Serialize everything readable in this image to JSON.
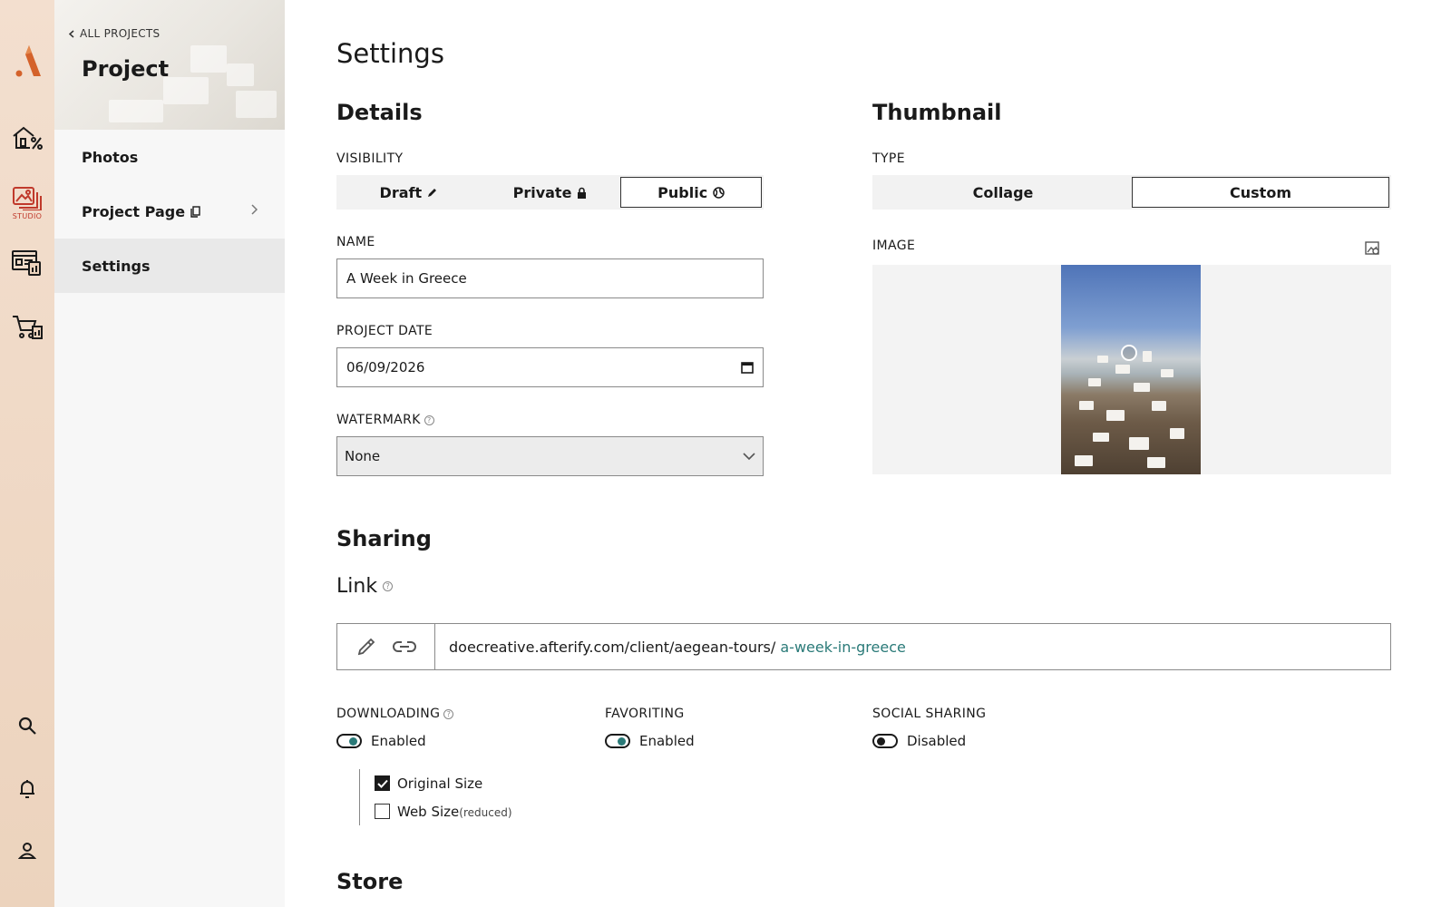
{
  "rail": {
    "logo": "afterify-logo-icon",
    "items": [
      {
        "name": "home-clients",
        "icon": "house-percent-icon"
      },
      {
        "name": "studio",
        "icon": "gallery-icon",
        "label": "STUDIO",
        "active": true
      },
      {
        "name": "websites",
        "icon": "website-icon"
      },
      {
        "name": "store",
        "icon": "cart-icon"
      }
    ],
    "bottom": [
      "search-icon",
      "bell-icon",
      "user-icon"
    ],
    "accent": "#c0392b"
  },
  "sidebar": {
    "back_label": "ALL PROJECTS",
    "title": "Project",
    "items": [
      {
        "label": "Photos"
      },
      {
        "label": "Project Page"
      },
      {
        "label": "Settings",
        "active": true
      }
    ]
  },
  "main": {
    "title": "Settings",
    "details": {
      "heading": "Details",
      "visibility": {
        "label": "VISIBILITY",
        "options": [
          "Draft",
          "Private",
          "Public"
        ],
        "selected": "Public"
      },
      "name": {
        "label": "NAME",
        "value": "A Week in Greece"
      },
      "date": {
        "label": "PROJECT DATE",
        "value": "06/09/2026"
      },
      "watermark": {
        "label": "WATERMARK",
        "value": "None"
      }
    },
    "thumbnail": {
      "heading": "Thumbnail",
      "type_label": "TYPE",
      "options": [
        "Collage",
        "Custom"
      ],
      "selected": "Custom",
      "image_label": "IMAGE"
    },
    "sharing": {
      "heading": "Sharing",
      "link_heading": "Link",
      "link_base": "doecreative.afterify.com/client/aegean-tours/",
      "link_slug": "a-week-in-greece",
      "downloading": {
        "label": "DOWNLOADING",
        "state": "Enabled"
      },
      "favoriting": {
        "label": "FAVORITING",
        "state": "Enabled"
      },
      "social": {
        "label": "SOCIAL SHARING",
        "state": "Disabled"
      },
      "sizes": [
        {
          "label": "Original Size",
          "checked": true,
          "note": ""
        },
        {
          "label": "Web Size",
          "checked": false,
          "note": "(reduced)"
        }
      ]
    },
    "store": {
      "heading": "Store"
    }
  },
  "colors": {
    "accent_teal": "#2a7a78",
    "brand_orange": "#d4622b"
  }
}
